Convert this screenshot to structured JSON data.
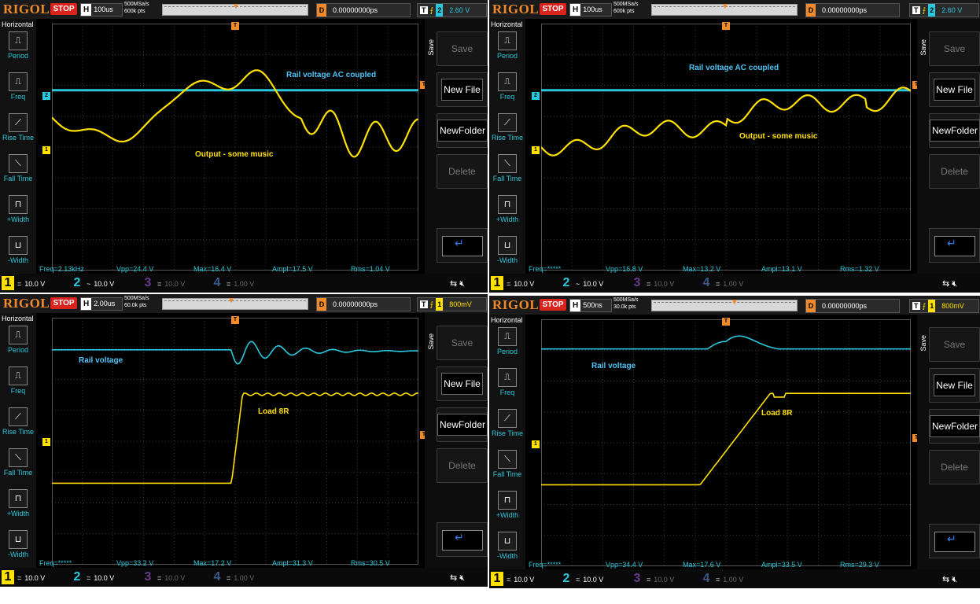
{
  "scopes": [
    {
      "logo": "RIGOL",
      "status": "STOP",
      "hlabel": "H",
      "timebase": "100us",
      "rate1": "500MSa/s",
      "rate2": "600k pts",
      "delay_label": "D",
      "delay": "0.00000000ps",
      "trig_type": "T",
      "trig_channel": "2",
      "trig_level": "2.60 V",
      "trig_color": "cyan",
      "horizontal_title": "Horizontal",
      "left_items": [
        "Period",
        "Freq",
        "Rise Time",
        "Fall Time",
        "+Width",
        "-Width"
      ],
      "right_title": "Save",
      "right_buttons": [
        "Save",
        "New File",
        "NewFolder",
        "Delete"
      ],
      "measurements": [
        "Freq=2.13kHz",
        "Vpp=24.4 V",
        "Max=16.4 V",
        "Ampl=17.5 V",
        "Rms=1.04 V"
      ],
      "channels": [
        {
          "num": "1",
          "coupling": "=",
          "scale": "10.0 V"
        },
        {
          "num": "2",
          "coupling": "~",
          "scale": "10.0 V"
        },
        {
          "num": "3",
          "coupling": "=",
          "scale": "10.0 V"
        },
        {
          "num": "4",
          "coupling": "=",
          "scale": "1.00 V"
        }
      ],
      "annotations": [
        {
          "text": "Rail voltage AC coupled",
          "color": "cy"
        },
        {
          "text": "Output - some music",
          "color": "yl"
        }
      ]
    },
    {
      "logo": "RIGOL",
      "status": "STOP",
      "hlabel": "H",
      "timebase": "100us",
      "rate1": "500MSa/s",
      "rate2": "600k pts",
      "delay_label": "D",
      "delay": "0.00000000ps",
      "trig_type": "T",
      "trig_channel": "2",
      "trig_level": "2.60 V",
      "trig_color": "cyan",
      "horizontal_title": "Horizontal",
      "left_items": [
        "Period",
        "Freq",
        "Rise Time",
        "Fall Time",
        "+Width",
        "-Width"
      ],
      "right_title": "Save",
      "right_buttons": [
        "Save",
        "New File",
        "NewFolder",
        "Delete"
      ],
      "measurements": [
        "Freq=*****",
        "Vpp=16.8 V",
        "Max=13.2 V",
        "Ampl=13.1 V",
        "Rms=1.32 V"
      ],
      "channels": [
        {
          "num": "1",
          "coupling": "=",
          "scale": "10.0 V"
        },
        {
          "num": "2",
          "coupling": "~",
          "scale": "10.0 V"
        },
        {
          "num": "3",
          "coupling": "=",
          "scale": "10.0 V"
        },
        {
          "num": "4",
          "coupling": "=",
          "scale": "1.00 V"
        }
      ],
      "annotations": [
        {
          "text": "Rail voltage AC coupled",
          "color": "cy"
        },
        {
          "text": "Output - some music",
          "color": "yl"
        }
      ]
    },
    {
      "logo": "RIGOL",
      "status": "STOP",
      "hlabel": "H",
      "timebase": "2.00us",
      "rate1": "500MSa/s",
      "rate2": "60.0k pts",
      "delay_label": "D",
      "delay": "0.00000000ps",
      "trig_type": "T",
      "trig_channel": "1",
      "trig_level": "800mV",
      "trig_color": "yellow",
      "horizontal_title": "Horizontal",
      "left_items": [
        "Period",
        "Freq",
        "Rise Time",
        "Fall Time",
        "+Width",
        "-Width"
      ],
      "right_title": "Save",
      "right_buttons": [
        "Save",
        "New File",
        "NewFolder",
        "Delete"
      ],
      "measurements": [
        "Freq=*****",
        "Vpp=33.2 V",
        "Max=17.2 V",
        "Ampl=31.3 V",
        "Rms=30.5 V"
      ],
      "channels": [
        {
          "num": "1",
          "coupling": "=",
          "scale": "10.0 V"
        },
        {
          "num": "2",
          "coupling": "=",
          "scale": "10.0 V"
        },
        {
          "num": "3",
          "coupling": "=",
          "scale": "10.0 V"
        },
        {
          "num": "4",
          "coupling": "=",
          "scale": "1.00 V"
        }
      ],
      "annotations": [
        {
          "text": "Rail voltage",
          "color": "cy"
        },
        {
          "text": "Load 8R",
          "color": "yl"
        }
      ]
    },
    {
      "logo": "RIGOL",
      "status": "STOP",
      "hlabel": "H",
      "timebase": "500ns",
      "rate1": "500MSa/s",
      "rate2": "30.0k pts",
      "delay_label": "D",
      "delay": "0.00000000ps",
      "trig_type": "T",
      "trig_channel": "1",
      "trig_level": "800mV",
      "trig_color": "yellow",
      "horizontal_title": "Horizontal",
      "left_items": [
        "Period",
        "Freq",
        "Rise Time",
        "Fall Time",
        "+Width",
        "-Width"
      ],
      "right_title": "Save",
      "right_buttons": [
        "Save",
        "New File",
        "NewFolder",
        "Delete"
      ],
      "measurements": [
        "Freq=*****",
        "Vpp=34.4 V",
        "Max=17.6 V",
        "Ampl=33.5 V",
        "Rms=29.3 V"
      ],
      "channels": [
        {
          "num": "1",
          "coupling": "=",
          "scale": "10.0 V"
        },
        {
          "num": "2",
          "coupling": "=",
          "scale": "10.0 V"
        },
        {
          "num": "3",
          "coupling": "=",
          "scale": "10.0 V"
        },
        {
          "num": "4",
          "coupling": "=",
          "scale": "1.00 V"
        }
      ],
      "annotations": [
        {
          "text": "Rail voltage",
          "color": "cy"
        },
        {
          "text": "Load 8R",
          "color": "yl"
        }
      ]
    }
  ],
  "colors": {
    "ch1": "#ffe100",
    "ch2": "#2ac8dc",
    "trigger": "#f08a2a",
    "stop": "#d9231d",
    "grid": "#3a3a3a"
  }
}
